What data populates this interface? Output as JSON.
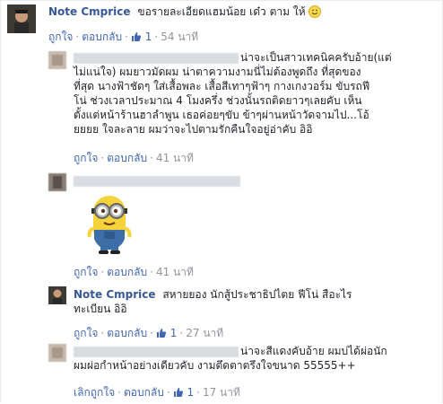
{
  "comment1": {
    "author": "Note Cmprice",
    "text": "ขอรายละเอียดแฮมน้อย เด๋ว ตาม ให้",
    "emoji": "smiley-icon",
    "like_label": "ถูกใจ",
    "reply_label": "ตอบกลับ",
    "likes": "1",
    "time": "54 นาที"
  },
  "reply1": {
    "lines": [
      "น่าจะเป็นสาวเทคนิคครับอ้าย(แต่",
      "ไม่แน่ใจ) ผมยาวมัดผม น่าตาความงามนี่ไม่ต้องพูดถึง ที่สุดของ",
      "ที่สุด นางฟ้าชัดๆ ใส่เสื้อพละ เสื้อสีเทาๆฟ้าๆ กางเกงวอร์ม ขับรถฟี",
      "โน่ ช่วงเวลาประมาณ 4 โมงครึ่ง ช่วงนั้นรถติดยาวๆเลยคับ เห็น",
      "ตั้งแต่หน้าร้านฮาลำพูน เธอค่อยๆขับ ข้าๆผ่านหน้าวัดจามไป...โอ้",
      "ยยยย ใจละลาย ผมว่าจะไปตามรักคืนใจอยู่อ่าคับ อิอิ"
    ],
    "like_label": "ถูกใจ",
    "reply_label": "ตอบกลับ",
    "time": "41 นาที"
  },
  "reply2": {
    "sticker": "minion-sticker",
    "like_label": "ถูกใจ",
    "reply_label": "ตอบกลับ",
    "time": "41 นาที"
  },
  "reply3": {
    "author": "Note Cmprice",
    "line1": "สหายยอง นักสู้ประชาธิปไตย ฟีโน่ สือะไร",
    "line2": "ทะเบียน อิอิ",
    "like_label": "ถูกใจ",
    "reply_label": "ตอบกลับ",
    "likes": "1",
    "time": "27 นาที"
  },
  "reply4": {
    "line1": "น่าจะสีแดงคับอ้าย ผมบ่ได้ผ่อนัก",
    "line2": "ผมผ่อกำหน้าอย่างเดียวคับ งามตึดตาตรึงใจขนาด 55555++",
    "like_label": "เลิกถูกใจ",
    "reply_label": "ตอบกลับ",
    "likes": "1",
    "time": "17 นาที"
  },
  "colors": {
    "link": "#365899",
    "action": "#4267b2",
    "meta": "#90949c",
    "text": "#1d2129"
  }
}
